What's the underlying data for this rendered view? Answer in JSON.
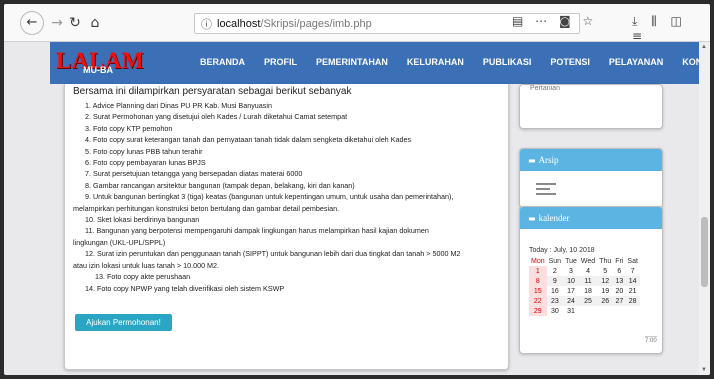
{
  "browser": {
    "url_host": "localhost",
    "url_path": "/Skripsi/pages/imb.php",
    "icons": [
      "back-arrow-icon",
      "forward-arrow-icon",
      "reload-icon",
      "home-icon",
      "info-icon",
      "reader-view-icon",
      "more-icon",
      "pocket-icon",
      "bookmark-star-icon",
      "download-icon",
      "library-icon",
      "sidebar-icon",
      "menu-icon"
    ]
  },
  "site": {
    "logo_main": "LALAM",
    "logo_sub": "MU-BA",
    "menu": [
      "BERANDA",
      "PROFIL",
      "PEMERINTAHAN",
      "KELURAHAN",
      "PUBLIKASI",
      "POTENSI",
      "PELAYANAN",
      "KONTAK"
    ]
  },
  "content": {
    "intro": "Bersama ini dilampirkan persyaratan sebagai berikut sebanyak",
    "requirements": [
      "1. Advice Planning dari Dinas PU PR Kab. Musi Banyuasin",
      "2. Surat Permohonan yang disetujui oleh Kades / Lurah diketahui Camat setempat",
      "3. Foto copy KTP pemohon",
      "4. Foto copy surat keterangan tanah dan pernyataan tanah tidak dalam sengketa diketahui oleh Kades",
      "5. Foto copy lunas PBB tahun terahir",
      "6. Foto copy pembayaran lunas BPJS",
      "7. Surat persetujuan tetangga yang bersepadan diatas materai 6000",
      "8. Gambar rancangan arsitektur bangunan (tampak depan, belakang, kiri dan kanan)",
      "9. Untuk bangunan bertingkat 3 (tiga) keatas (bangunan untuk kepentingan umum, untuk  usaha dan pemerintahan),",
      "melampirkan perhitungan konstruksi beton bertulang dan gambar detail pembesian.",
      "10. Sket lokasi berdirinya bangunan",
      "11. Bangunan yang berpotensi mempengaruhi dampak lingkungan harus melampirkan hasil kajian dokumen",
      "lingkungan (UKL-UPL/SPPL)",
      "12. Surat izin peruntukan dan penggunaan tanah (SIPPT) untuk bangunan lebih dari dua tingkat dan tanah > 5000 M2",
      "atau izin lokasi untuk luas tanah > 10.000 M2.",
      "13. Foto copy akte perushaan",
      "14. Foto copy NPWP yang telah diverifikasi oleh sistem KSWP"
    ],
    "submit_label": "Ajukan Permohonan!"
  },
  "sidebar": {
    "top_panel_cut_text": "Pertanian",
    "arsip_title": "Arsip",
    "kalender_title": "kalender",
    "today_label": "Today : July, 10 2018",
    "weekdays": [
      "Mon",
      "Sun",
      "Tue",
      "Wed",
      "Thu",
      "Fri",
      "Sat"
    ],
    "weeks": [
      [
        "1",
        "2",
        "3",
        "4",
        "5",
        "6",
        "7"
      ],
      [
        "8",
        "9",
        "10",
        "11",
        "12",
        "13",
        "14"
      ],
      [
        "15",
        "16",
        "17",
        "18",
        "19",
        "20",
        "21"
      ],
      [
        "22",
        "23",
        "24",
        "25",
        "26",
        "27",
        "28"
      ],
      [
        "29",
        "30",
        "31",
        "",
        "",
        "",
        ""
      ]
    ],
    "footer": "7:00"
  },
  "colors": {
    "header_blue": "#3b6fb6",
    "panel_blue": "#5bb4e2",
    "button_teal": "#2aa6c4",
    "logo_red": "#e11111"
  }
}
